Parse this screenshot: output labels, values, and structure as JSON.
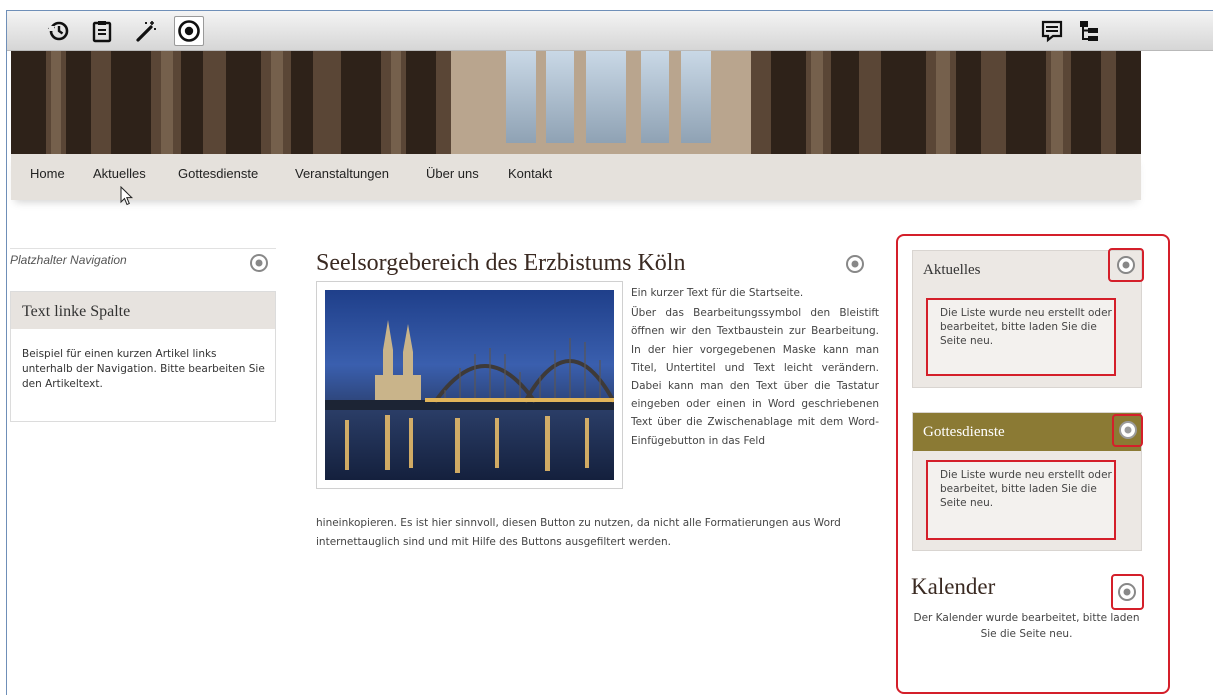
{
  "toolbar": {
    "icons_left": [
      "history-icon",
      "clipboard-icon",
      "magic-wand-icon",
      "target-icon"
    ],
    "icons_right": [
      "comment-list-icon",
      "sitemap-icon"
    ],
    "active_icon": "target-icon"
  },
  "nav": {
    "items": [
      "Home",
      "Aktuelles",
      "Gottesdienste",
      "Veranstaltungen",
      "Über uns",
      "Kontakt"
    ]
  },
  "left": {
    "placeholder_label": "Platzhalter Navigation",
    "box_title": "Text linke Spalte",
    "box_text": "Beispiel für einen kurzen Artikel links unterhalb der Navigation. Bitte bearbeiten Sie den Artikeltext."
  },
  "main": {
    "title": "Seelsorgebereich des Erzbistums Köln",
    "intro": "Ein kurzer Text für die Startseite.",
    "body": "Über das Bearbeitungssymbol den Bleistift öffnen wir den Textbaustein zur Bearbeitung. In der hier vorgegebenen Maske kann man Titel, Untertitel und Text leicht verändern. Dabei kann man den Text über die Tastatur eingeben oder einen in Word geschriebenen Text über die Zwischenablage mit dem Word-Einfügebutton in das Feld",
    "tail": "hineinkopieren. Es ist hier sinnvoll, diesen Button zu nutzen, da nicht alle Formatierungen aus Word internettauglich sind und mit Hilfe des Buttons ausgefiltert werden."
  },
  "right": {
    "box1_title": "Aktuelles",
    "box1_msg": "Die Liste wurde neu erstellt oder bearbeitet, bitte laden Sie die Seite neu.",
    "box2_title": "Gottesdienste",
    "box2_msg": "Die Liste wurde neu erstellt oder bearbeitet, bitte laden Sie die Seite neu.",
    "kal_title": "Kalender",
    "kal_text": "Der Kalender wurde bearbeitet, bitte laden Sie die Seite neu."
  },
  "colors": {
    "highlight_red": "#d41f2a",
    "olive_header": "#8b7a34",
    "nav_bg": "#e5e1dc"
  }
}
